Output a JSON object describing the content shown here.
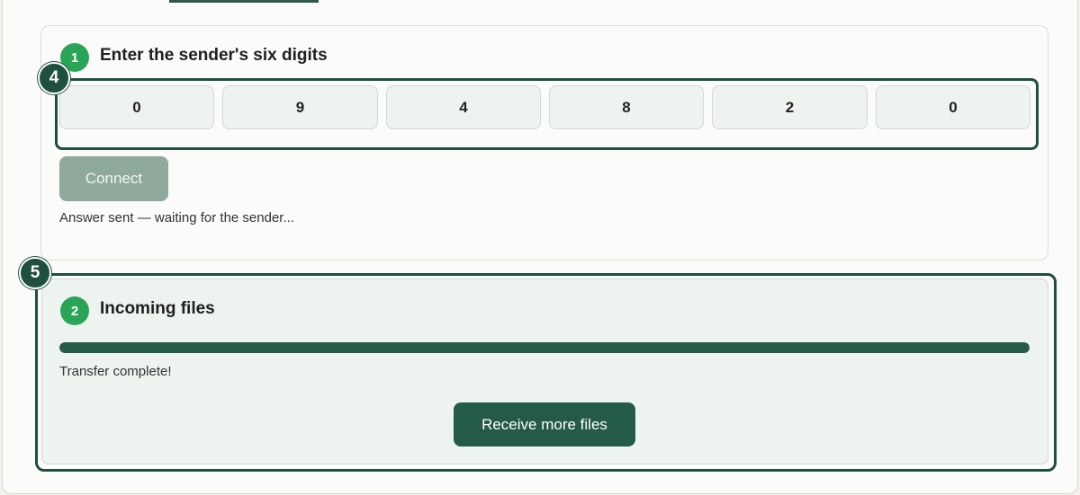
{
  "step1": {
    "number": "1",
    "title": "Enter the sender's six digits",
    "digits": [
      "0",
      "9",
      "4",
      "8",
      "2",
      "0"
    ],
    "connect_label": "Connect",
    "status": "Answer sent — waiting for the sender..."
  },
  "step2": {
    "number": "2",
    "title": "Incoming files",
    "progress": 1.0,
    "status": "Transfer complete!",
    "receive_more_label": "Receive more files"
  },
  "markers": {
    "digits_marker": "4",
    "incoming_marker": "5"
  },
  "colors": {
    "accent_dark": "#245a48",
    "step_badge": "#2aa557",
    "connect_disabled": "#8fa99c"
  }
}
